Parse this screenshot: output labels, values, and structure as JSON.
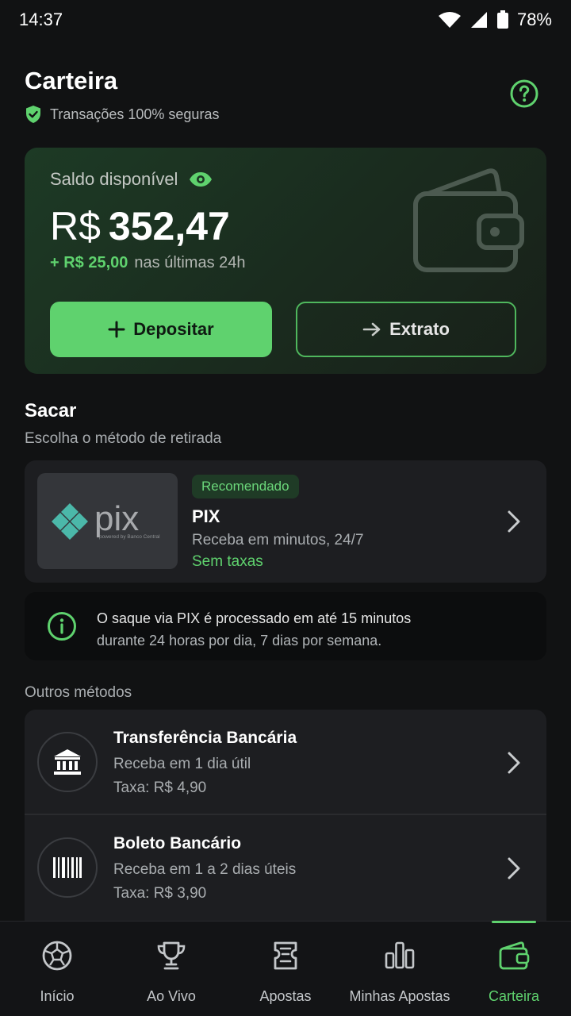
{
  "status": {
    "time": "14:37",
    "battery": "78%"
  },
  "header": {
    "title": "Carteira",
    "secure_text": "Transações 100% seguras"
  },
  "balance": {
    "label": "Saldo disponível",
    "currency": "R$",
    "amount": "352,47",
    "delta": "+ R$ 25,00",
    "delta_suffix": "nas últimas 24h",
    "deposit_label": "Depositar",
    "extrato_label": "Extrato"
  },
  "withdraw": {
    "title": "Sacar",
    "subtitle": "Escolha o método de retirada",
    "pix": {
      "badge": "Recomendado",
      "name": "PIX",
      "desc": "Receba em minutos, 24/7",
      "fee": "Sem taxas",
      "logo_text": "pix",
      "logo_sub": "powered by Banco Central"
    },
    "info": {
      "line1": "O saque via PIX é processado em até 15 minutos",
      "line2": "durante 24 horas por dia, 7 dias por semana."
    },
    "others_label": "Outros métodos",
    "methods": [
      {
        "name": "Transferência Bancária",
        "desc": "Receba em 1 dia útil",
        "fee": "Taxa: R$ 4,90",
        "icon": "bank-icon"
      },
      {
        "name": "Boleto Bancário",
        "desc": "Receba em 1 a 2 dias úteis",
        "fee": "Taxa: R$ 3,90",
        "icon": "barcode-icon"
      }
    ]
  },
  "nav": {
    "items": [
      {
        "label": "Início",
        "icon": "soccer-ball-icon"
      },
      {
        "label": "Ao Vivo",
        "icon": "trophy-icon"
      },
      {
        "label": "Apostas",
        "icon": "ticket-icon"
      },
      {
        "label": "Minhas Apostas",
        "icon": "bar-chart-icon"
      },
      {
        "label": "Carteira",
        "icon": "wallet-icon"
      }
    ],
    "active": "Carteira"
  },
  "colors": {
    "accent": "#5fd26e",
    "background": "#111213",
    "card": "#1d1e21"
  }
}
